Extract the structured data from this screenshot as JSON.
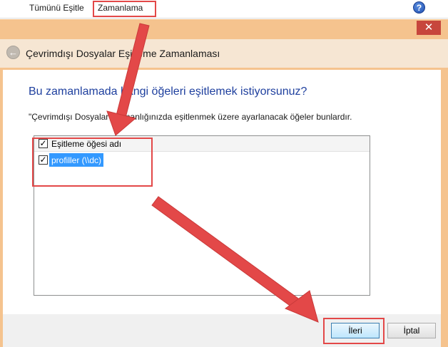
{
  "menubar": {
    "sync_all": "Tümünü Eşitle",
    "schedule": "Zamanlama",
    "help_glyph": "?"
  },
  "dialog": {
    "close_glyph": "✕",
    "back_glyph": "←",
    "title": "Çevrimdışı Dosyalar Eşitleme Zamanlaması",
    "question": "Bu zamanlamada hangi öğeleri eşitlemek istiyorsunuz?",
    "description": "\"Çevrimdışı Dosyalar\" zamanlığınızda eşitlenmek üzere ayarlanacak öğeler bunlardır."
  },
  "list": {
    "header_label": "Eşitleme öğesi adı",
    "header_checked": true,
    "items": [
      {
        "label": "profiller (\\\\dc)",
        "checked": true,
        "selected": true
      }
    ]
  },
  "buttons": {
    "next_label": "İleri",
    "cancel_label": "İptal"
  },
  "colors": {
    "annotation": "#e34848",
    "frame": "#f5c38e",
    "selection": "#3399ff",
    "question_text": "#1e3f9e"
  },
  "icons": {
    "help": "help-icon",
    "close": "close-icon",
    "back": "back-arrow-icon",
    "check": "checkmark-icon"
  }
}
